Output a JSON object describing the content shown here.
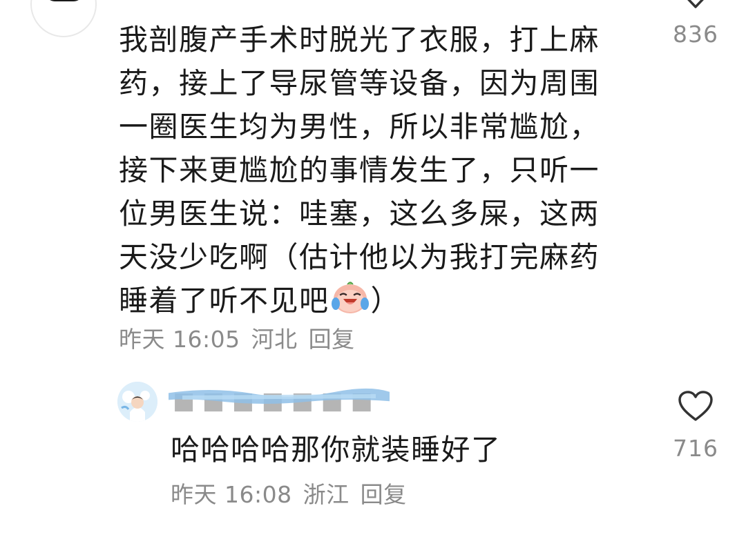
{
  "comment": {
    "lines": [
      "我剖腹产手术时脱光了衣服，打上麻",
      "药，接上了导尿管等设备，因为周围",
      "一圈医生均为男性，所以非常尴尬，",
      "接下来更尴尬的事情发生了，只听一",
      "位男医生说：哇塞，这么多屎，这两",
      "天没少吃啊（估计他以为我打完麻药",
      "睡着了听不见吧"
    ],
    "line_end": "）",
    "emoji": "crying-laughing-emoji",
    "time": "昨天 16:05",
    "location": "河北",
    "reply_label": "回复",
    "like_count": "836",
    "like_icon": "heart-outline-icon"
  },
  "reply": {
    "text": "哈哈哈哈那你就装睡好了",
    "time": "昨天 16:08",
    "location": "浙江",
    "reply_label": "回复",
    "like_count": "716",
    "like_icon": "heart-outline-icon"
  },
  "colors": {
    "text": "#1a1a1a",
    "meta": "#8a8a8a",
    "name_blur": "#8fc0e8"
  }
}
